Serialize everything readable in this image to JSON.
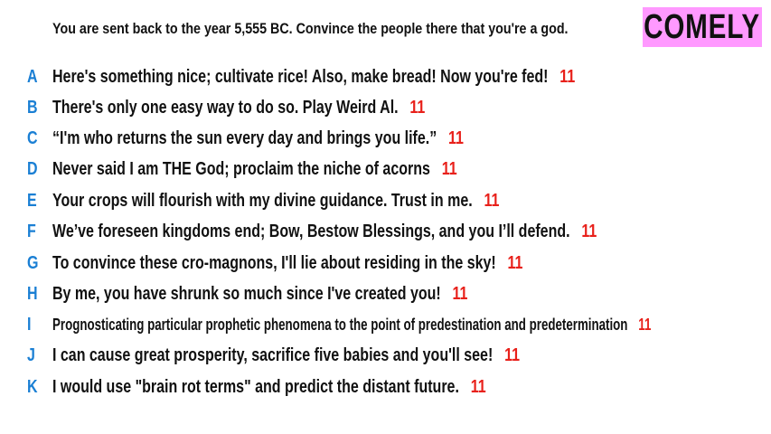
{
  "prompt": "You are sent back to the year 5,555 BC. Convince the people there that you're a god.",
  "brand": "COMELY",
  "colors": {
    "letter": "#1a7fd4",
    "score": "#e8201a",
    "brand_bg": "#ff99ff",
    "text": "#111111"
  },
  "answers": [
    {
      "letter": "A",
      "text": "Here's something nice; cultivate rice! Also, make bread! Now you're fed!",
      "score": "11"
    },
    {
      "letter": "B",
      "text": "There's only one easy way to do so. Play Weird Al.",
      "score": "11"
    },
    {
      "letter": "C",
      "text": "“I'm who returns the sun every day and brings you life.”",
      "score": "11"
    },
    {
      "letter": "D",
      "text": "Never said I am THE God; proclaim the niche of acorns",
      "score": "11"
    },
    {
      "letter": "E",
      "text": "Your crops will flourish with my divine guidance. Trust in me.",
      "score": "11"
    },
    {
      "letter": "F",
      "text": "We’ve foreseen kingdoms end; Bow, Bestow Blessings, and you I’ll defend.",
      "score": "11"
    },
    {
      "letter": "G",
      "text": "To convince these cro-magnons, I'll lie about residing in the sky!",
      "score": "11"
    },
    {
      "letter": "H",
      "text": "By me, you have shrunk so much since I've created you!",
      "score": "11"
    },
    {
      "letter": "I",
      "text": "Prognosticating particular prophetic phenomena to the point of predestination and predetermination",
      "score": "11"
    },
    {
      "letter": "J",
      "text": "I can cause great prosperity, sacrifice five babies and you'll see!",
      "score": "11"
    },
    {
      "letter": "K",
      "text": "I would use \"brain rot terms\" and predict the distant future.",
      "score": "11"
    }
  ]
}
